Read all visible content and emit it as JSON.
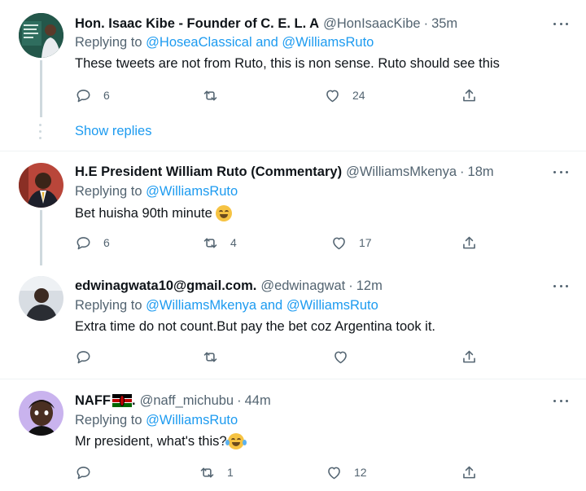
{
  "colors": {
    "accent": "#1d9bf0",
    "muted": "#536471",
    "text": "#0f1419",
    "divider": "#eff3f4"
  },
  "tweets": [
    {
      "name": "Hon. Isaac Kibe - Founder of C. E. L. A",
      "handle": "@HonIsaacKibe",
      "sep": "·",
      "time": "35m",
      "replying_prefix": "Replying to",
      "mentions": [
        "@HoseaClassical",
        "@WilliamsRuto"
      ],
      "mention_join": "and",
      "text": "These tweets are not from Ruto, this is non sense. Ruto should see this",
      "reply_count": "6",
      "retweet_count": "",
      "like_count": "24",
      "show_replies": "Show replies"
    },
    {
      "name": "H.E President William Ruto (Commentary)",
      "handle": "@WilliamsMkenya",
      "sep": "·",
      "time": "18m",
      "replying_prefix": "Replying to",
      "mentions": [
        "@WilliamsRuto"
      ],
      "text": "Bet huisha 90th minute",
      "emoji": "grinning-squinting-face",
      "reply_count": "6",
      "retweet_count": "4",
      "like_count": "17"
    },
    {
      "name": "edwinagwata10@gmail.com.",
      "handle": "@edwinagwat",
      "sep": "·",
      "time": "12m",
      "replying_prefix": "Replying to",
      "mentions": [
        "@WilliamsMkenya",
        "@WilliamsRuto"
      ],
      "mention_join": "and",
      "text": "Extra time do not count.But pay the bet coz Argentina took it.",
      "reply_count": "",
      "retweet_count": "",
      "like_count": ""
    },
    {
      "name": "NAFF",
      "name_suffix": ".",
      "name_flag": "kenya-flag",
      "handle": "@naff_michubu",
      "sep": "·",
      "time": "44m",
      "replying_prefix": "Replying to",
      "mentions": [
        "@WilliamsRuto"
      ],
      "text": "Mr president, what's this?",
      "emoji": "face-with-tears-of-joy",
      "reply_count": "",
      "retweet_count": "1",
      "like_count": "12"
    }
  ]
}
